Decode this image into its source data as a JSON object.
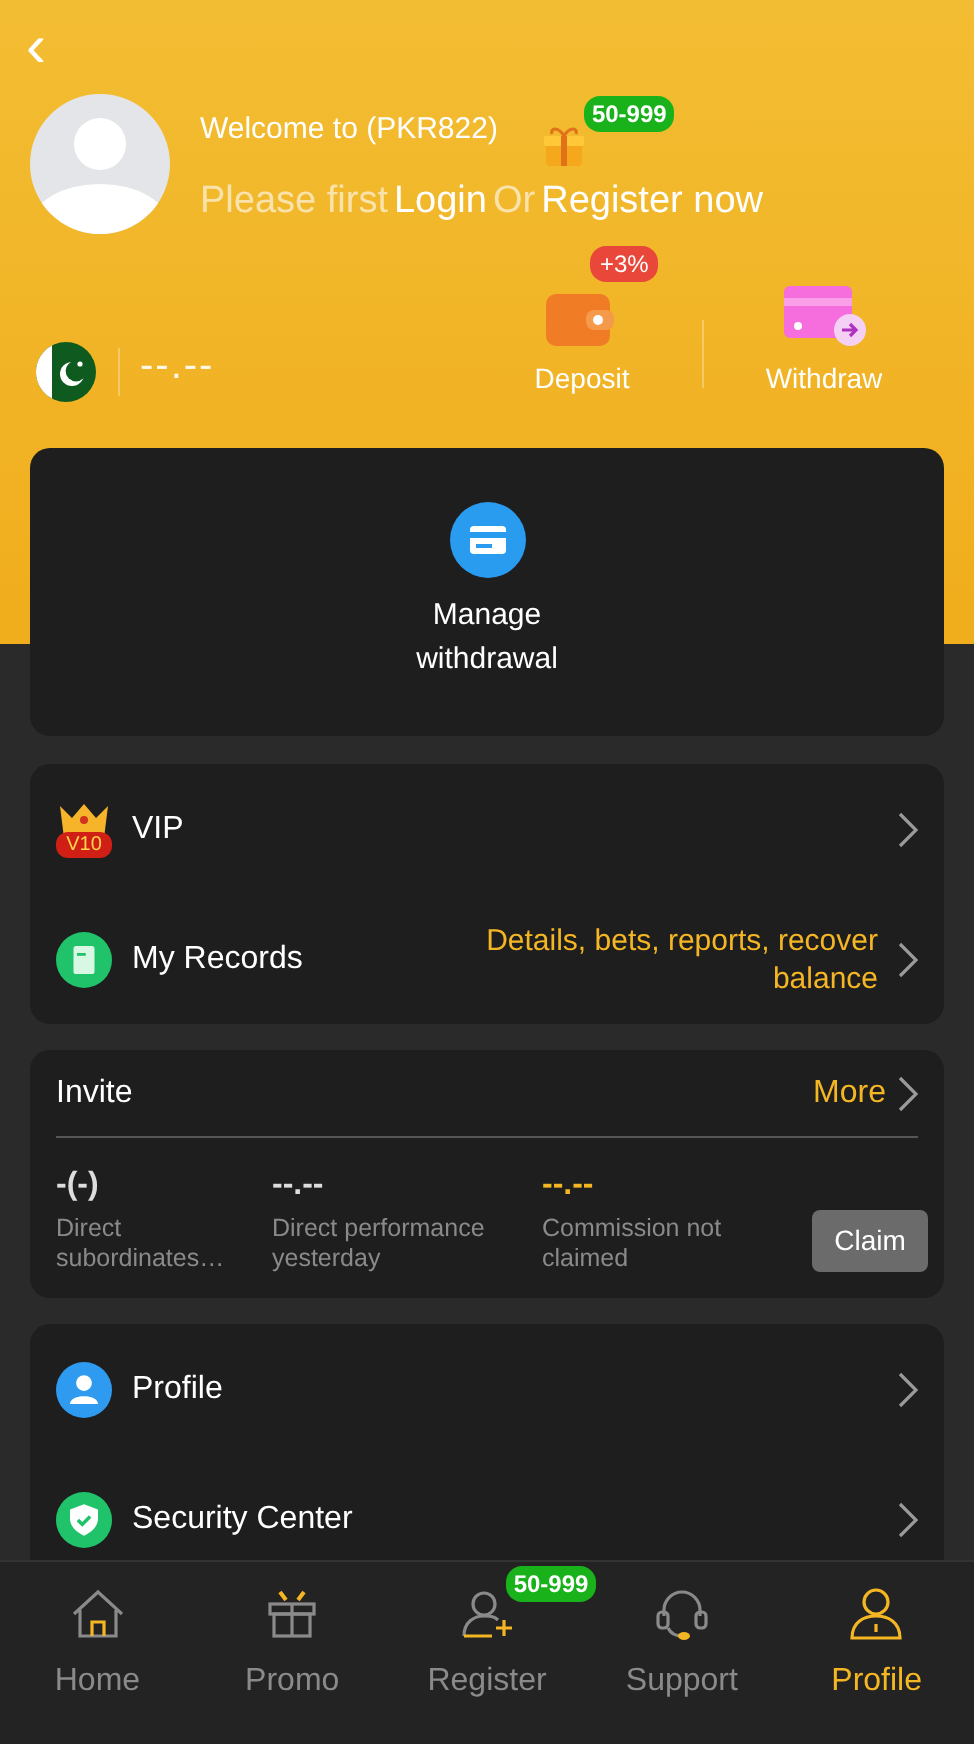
{
  "header": {
    "back": "‹",
    "welcome": "Welcome to (PKR822)",
    "gift_badge": "50-999",
    "prompt": [
      {
        "text": "Please first",
        "emphasis": false
      },
      {
        "text": "Login",
        "emphasis": true
      },
      {
        "text": "Or",
        "emphasis": false
      },
      {
        "text": "Register now",
        "emphasis": true
      }
    ],
    "balance": "--.--",
    "actions": [
      {
        "kind": "deposit",
        "label": "Deposit",
        "badge": "+3%"
      },
      {
        "kind": "withdraw",
        "label": "Withdraw"
      }
    ]
  },
  "withdrawal_card": {
    "label": "Manage withdrawal"
  },
  "menu": [
    {
      "kind": "vip",
      "label": "VIP",
      "vip_level": "V10"
    },
    {
      "kind": "records",
      "label": "My Records",
      "detail": "Details, bets, reports, recover balance"
    }
  ],
  "invite": {
    "title": "Invite",
    "more": "More",
    "stats": [
      {
        "value": "-(-)",
        "label": "Direct subordinates…",
        "highlight": false
      },
      {
        "value": "--.--",
        "label": "Direct performance yesterday",
        "highlight": false
      },
      {
        "value": "--.--",
        "label": "Commission not claimed",
        "highlight": true
      }
    ],
    "claim": "Claim"
  },
  "settings": [
    {
      "kind": "profile",
      "label": "Profile"
    },
    {
      "kind": "security",
      "label": "Security Center"
    }
  ],
  "tabs": [
    {
      "kind": "home",
      "label": "Home",
      "selected": false
    },
    {
      "kind": "promo",
      "label": "Promo",
      "selected": false
    },
    {
      "kind": "register",
      "label": "Register",
      "selected": false,
      "badge": "50-999"
    },
    {
      "kind": "support",
      "label": "Support",
      "selected": false
    },
    {
      "kind": "profile",
      "label": "Profile",
      "selected": true
    }
  ]
}
